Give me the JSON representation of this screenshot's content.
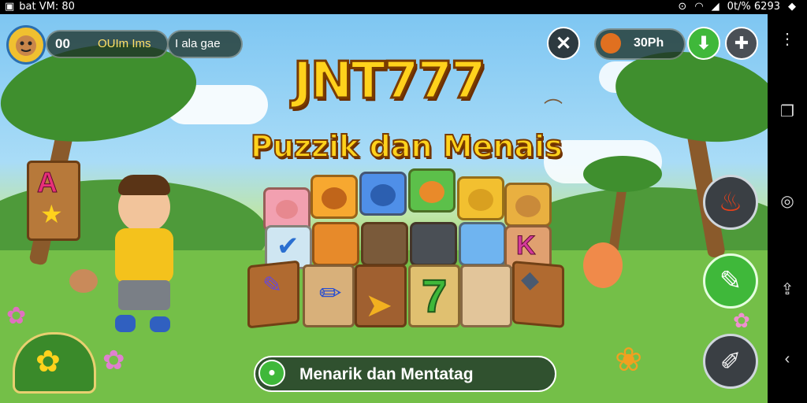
{
  "status_bar": {
    "left_text": "bat VM: 80",
    "right_text": "0t/% 6293"
  },
  "hud": {
    "score": "00",
    "label_a": "OUIm Ims",
    "label_b": "I ala gae",
    "coins": "30Ph"
  },
  "title": {
    "line1": "JNT777",
    "line2": "Puzzik dan Menais"
  },
  "tiles": {
    "letter_a": "A",
    "letter_k": "K",
    "number_7": "7"
  },
  "bottom_banner": {
    "text": "Menarik dan Mentatag"
  },
  "colors": {
    "title_yellow": "#ffd21c",
    "title_outline": "#7a3b00",
    "green_button": "#3fb83a",
    "dark_button": "#3a3f44"
  },
  "icons": [
    "avatar-icon",
    "close-icon",
    "coin-icon",
    "download-icon",
    "puzzle-icon",
    "fire-icon",
    "pencil-icon",
    "brush-icon",
    "flower-icon",
    "back-icon",
    "home-icon",
    "recent-icon"
  ]
}
